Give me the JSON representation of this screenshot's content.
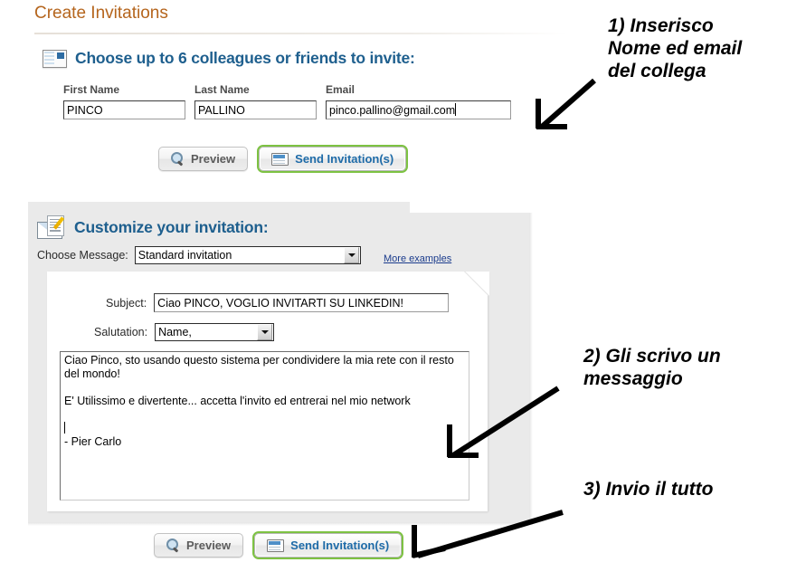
{
  "page": {
    "title": "Create Invitations",
    "title_color": "#b5651d",
    "accent_blue": "#1e5f8e",
    "highlight_green": "#7dc242"
  },
  "section_contacts": {
    "icon": "contacts-card-icon",
    "heading": "Choose up to 6 colleagues or friends to invite:",
    "fields": [
      {
        "name": "first-name",
        "label": "First Name",
        "value": "PINCO",
        "placeholder": ""
      },
      {
        "name": "last-name",
        "label": "Last Name",
        "value": "PALLINO",
        "placeholder": ""
      },
      {
        "name": "email",
        "label": "Email",
        "value": "pinco.pallino@gmail.com",
        "placeholder": ""
      }
    ],
    "buttons": {
      "preview_label": "Preview",
      "preview_icon": "magnifier-icon",
      "send_label": "Send Invitation(s)",
      "send_icon": "envelope-icon"
    }
  },
  "section_customize": {
    "icon": "compose-envelope-pencil-icon",
    "heading": "Customize your invitation:",
    "choose_message_label": "Choose Message:",
    "choose_message_value": "Standard invitation",
    "more_examples_label": "More examples",
    "subject_label": "Subject:",
    "subject_value": "Ciao PINCO, VOGLIO INVITARTI SU LINKEDIN!",
    "salutation_label": "Salutation:",
    "salutation_value": "Name,",
    "message_line1": "Ciao Pinco, sto usando questo sistema per condividere la mia rete con il resto del mondo!",
    "message_line2": "E' Utilissimo e divertente... accetta l'invito ed entrerai nel mio network",
    "message_line3": "- Pier Carlo",
    "buttons": {
      "preview_label": "Preview",
      "preview_icon": "magnifier-icon",
      "send_label": "Send Invitation(s)",
      "send_icon": "envelope-icon"
    }
  },
  "annotations": [
    {
      "name": "annotation-step-1",
      "text": "1) Inserisco\nNome ed email\ndel collega"
    },
    {
      "name": "annotation-step-2",
      "text": "2) Gli scrivo un\nmessaggio"
    },
    {
      "name": "annotation-step-3",
      "text": "3) Invio il tutto"
    }
  ]
}
